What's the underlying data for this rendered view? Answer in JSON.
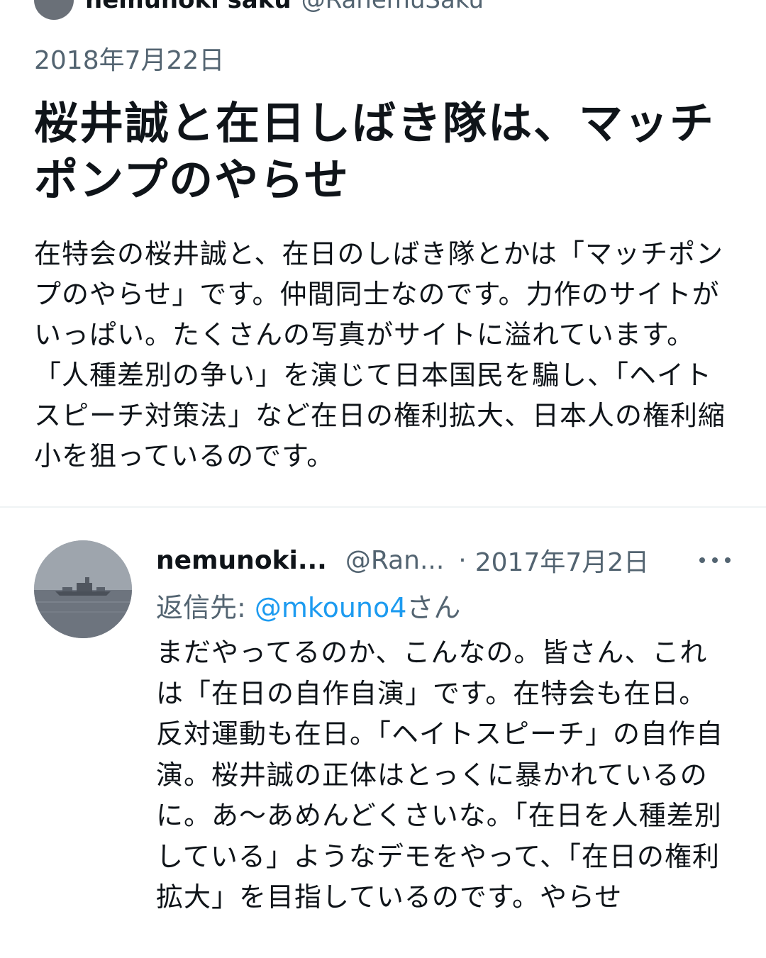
{
  "top_strip": {
    "name": "nemunoki saku",
    "handle": "@RanemuSaku"
  },
  "article": {
    "date": "2018年7月22日",
    "title": "桜井誠と在日しばき隊は、マッチポンプのやらせ",
    "body": "在特会の桜井誠と、在日のしばき隊とかは「マッチポンプのやらせ」です。仲間同士なのです。力作のサイトがいっぱい。たくさんの写真がサイトに溢れています。「人種差別の争い」を演じて日本国民を騙し、「ヘイトスピーチ対策法」など在日の権利拡大、日本人の権利縮小を狙っているのです。"
  },
  "tweet": {
    "name": "nemunoki...",
    "handle": "@Ran...",
    "dot": "·",
    "date": "2017年7月2日",
    "more_icon": "more-horizontal-icon",
    "reply_prefix": "返信先:",
    "reply_mention": "@mkouno4",
    "reply_suffix": "さん",
    "text": "まだやってるのか、こんなの。皆さん、これは「在日の自作自演」です。在特会も在日。反対運動も在日。「ヘイトスピーチ」の自作自演。桜井誠の正体はとっくに暴かれているのに。あ〜あめんどくさいな。「在日を人種差別している」ようなデモをやって、「在日の権利拡大」を目指しているのです。やらせ"
  },
  "colors": {
    "text_primary": "#0f1419",
    "text_secondary": "#536471",
    "mention": "#1d9bf0",
    "divider": "#eff3f4"
  }
}
